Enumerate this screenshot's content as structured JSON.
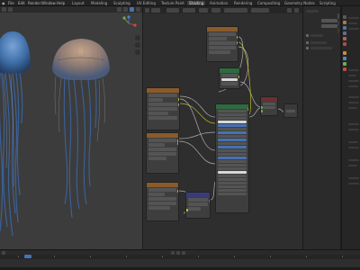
{
  "menu": {
    "items": [
      "File",
      "Edit",
      "Render",
      "Window",
      "Help"
    ],
    "workspaces": [
      "Layout",
      "Modeling",
      "Sculpting",
      "UV Editing",
      "Texture Paint",
      "Shading",
      "Animation",
      "Rendering",
      "Compositing",
      "Geometry Nodes",
      "Scripting"
    ]
  },
  "colors": {
    "accent": "#4772b3",
    "node_header_orange": "#8a5a2b",
    "node_header_green": "#2e6b3e",
    "node_header_teal": "#2b5a5a",
    "node_header_red": "#6b3030",
    "socket_yellow": "#c7c729",
    "socket_grey": "#a1a1a1",
    "socket_purple": "#6363c7",
    "jellyfish_blue": "#3e6ea8"
  }
}
